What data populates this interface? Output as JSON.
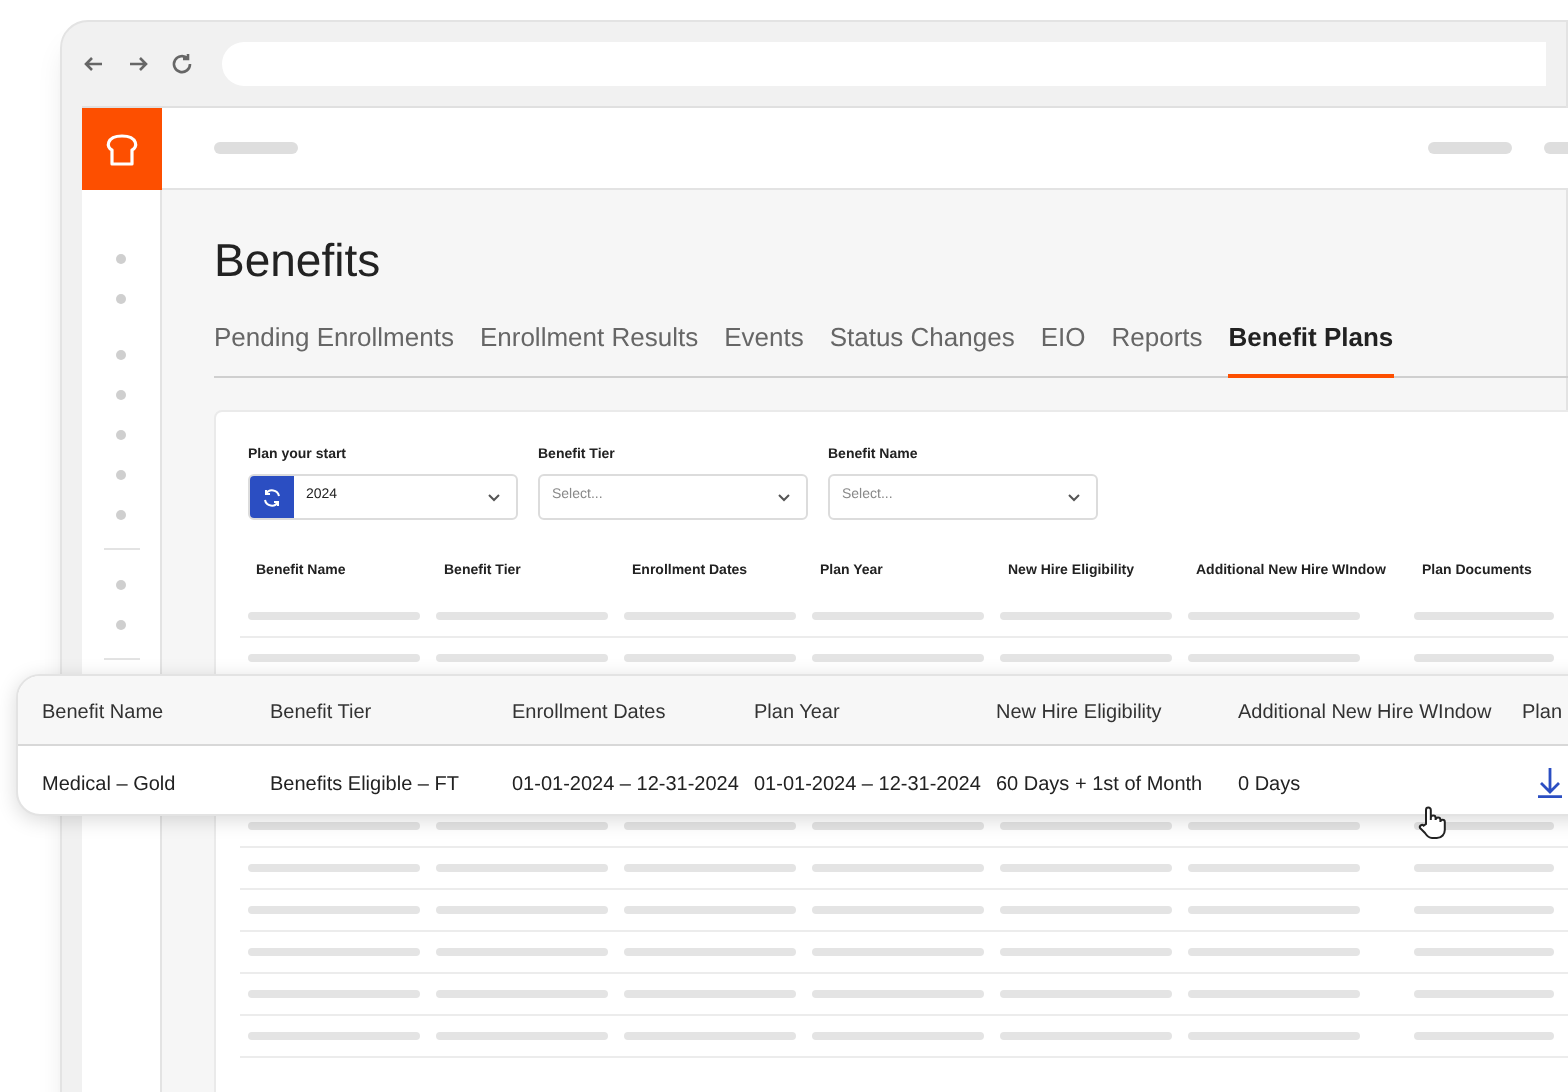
{
  "page": {
    "title": "Benefits"
  },
  "tabs": [
    {
      "label": "Pending Enrollments",
      "selected": false
    },
    {
      "label": "Enrollment Results",
      "selected": false
    },
    {
      "label": "Events",
      "selected": false
    },
    {
      "label": "Status Changes",
      "selected": false
    },
    {
      "label": "EIO",
      "selected": false
    },
    {
      "label": "Reports",
      "selected": false
    },
    {
      "label": "Benefit Plans",
      "selected": true
    }
  ],
  "filters": [
    {
      "label": "Plan your start",
      "value": "2024",
      "kind": "year"
    },
    {
      "label": "Benefit Tier",
      "placeholder": "Select...",
      "kind": "select"
    },
    {
      "label": "Benefit Name",
      "placeholder": "Select...",
      "kind": "select"
    }
  ],
  "table": {
    "columns": [
      "Benefit Name",
      "Benefit Tier",
      "Enrollment Dates",
      "Plan Year",
      "New Hire Eligibility",
      "Additional New Hire WIndow",
      "Plan Documents"
    ]
  },
  "highlighted_row": {
    "columns": [
      "Benefit Name",
      "Benefit Tier",
      "Enrollment Dates",
      "Plan Year",
      "New Hire Eligibility",
      "Additional New Hire WIndow",
      "Plan"
    ],
    "cells": [
      "Medical – Gold",
      "Benefits Eligible – FT",
      "01-01-2024 – 12-31-2024",
      "01-01-2024 – 12-31-2024",
      "60 Days + 1st of Month",
      "0 Days"
    ]
  }
}
